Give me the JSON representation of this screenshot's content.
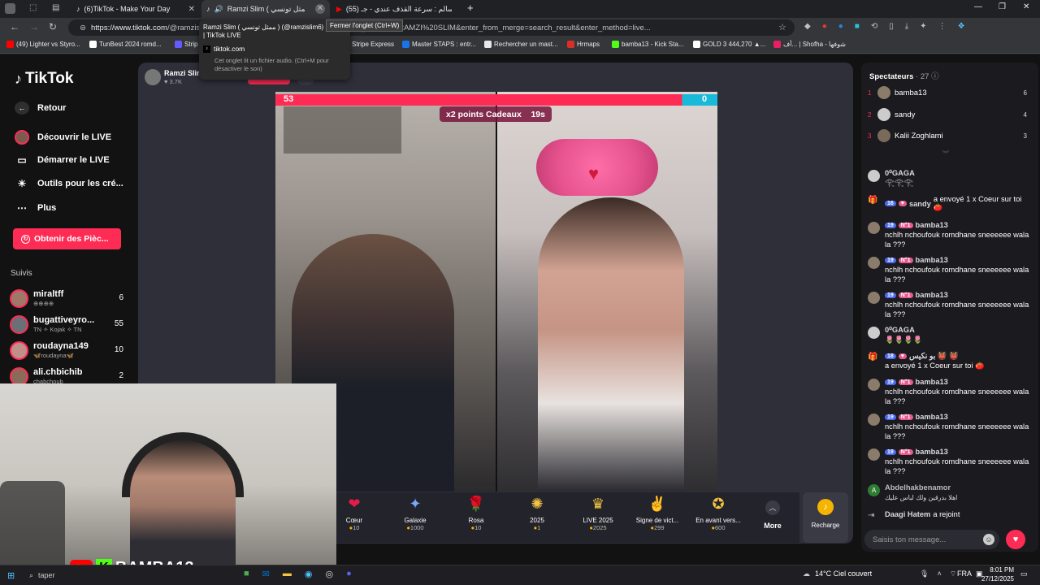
{
  "browser": {
    "tabs": [
      {
        "title": "(6)TikTok - Make Your Day",
        "active": false
      },
      {
        "title": "Ramzi Slim ( ممثل تونسي ) (",
        "active": true
      },
      {
        "title": "(55) سالم : سرعة القذف عندي - جـ",
        "active": false
      }
    ],
    "new_tab": "+",
    "url_host": "https://www.tiktok.com",
    "url_rest": "/@ramzislim",
    "url_tail": "0653EAACB0FA28&search_keyword=RAMZI%20SLIM&enter_from_merge=search_result&enter_method=live...",
    "tooltip": "Fermer l'onglet (Ctrl+W)",
    "hover_card": {
      "title": "Ramzi Slim ( ممثل تونسي ) (@ramzislim6) e LIVE | TikTok LIVE",
      "domain": "tiktok.com",
      "note": "Cet onglet lit un fichier audio. (Ctrl+M pour désactiver le son)"
    },
    "bookmarks": [
      {
        "label": "(49) Lighter vs Styro...",
        "color": "#ff0000"
      },
      {
        "label": "TunBest 2024 romd...",
        "color": "#ffffff"
      },
      {
        "label": "Strip",
        "color": "#635bff"
      },
      {
        "label": "Stripe Express",
        "color": "#635bff"
      },
      {
        "label": "Master STAPS : entr...",
        "color": "#1a73e8"
      },
      {
        "label": "Rechercher un mast...",
        "color": "#e8e8e8"
      },
      {
        "label": "Hrmaps",
        "color": "#d93025"
      },
      {
        "label": "bamba13 - Kick Sta...",
        "color": "#53fc18"
      },
      {
        "label": "GOLD 3 444,270 ▲...",
        "color": "#ffffff"
      },
      {
        "label": "أف... | Shofha - شوفها",
        "color": "#e91e63"
      }
    ]
  },
  "sidebar": {
    "logo": "TikTok",
    "back": "Retour",
    "items": [
      {
        "label": "Découvrir le LIVE",
        "icon": "live-avatar-icon"
      },
      {
        "label": "Démarrer le LIVE",
        "icon": "camera-icon"
      },
      {
        "label": "Outils pour les cré...",
        "icon": "lightbulb-icon"
      },
      {
        "label": "Plus",
        "icon": "more-dots-icon"
      }
    ],
    "coins_button": "Obtenir des Pièc...",
    "following_title": "Suivis",
    "following": [
      {
        "name": "miraltff",
        "sub": "⊕⊕⊕⊕",
        "count": "6"
      },
      {
        "name": "bugattiveyro...",
        "sub": "TN ✧ Kojak ✧ TN",
        "count": "55"
      },
      {
        "name": "roudayna149",
        "sub": "🦋roudayna🦋",
        "count": "10"
      },
      {
        "name": "ali.chbichib",
        "sub": "chabchoub",
        "count": "2"
      }
    ]
  },
  "stream": {
    "host_name": "Ramzi Slim",
    "host_viewers": "3.7K",
    "score_left": "53",
    "score_right": "0",
    "multiplier": "x2 points Cadeaux",
    "timer": "19s"
  },
  "gifts": [
    {
      "name": "Cœur",
      "price": "10",
      "icon": "❤"
    },
    {
      "name": "Galaxie",
      "price": "1000",
      "icon": "✦"
    },
    {
      "name": "Rosa",
      "price": "10",
      "icon": "🌹"
    },
    {
      "name": "2025",
      "price": "1",
      "icon": "✺"
    },
    {
      "name": "LIVE 2025",
      "price": "2025",
      "icon": "♛"
    },
    {
      "name": "Signe de vict...",
      "price": "299",
      "icon": "✌"
    },
    {
      "name": "En avant vers...",
      "price": "600",
      "icon": "✪"
    }
  ],
  "more_label": "More",
  "recharge_label": "Recharge",
  "chat": {
    "viewers_title": "Spectateurs",
    "viewers_count": "27",
    "ranking": [
      {
        "rank": "1",
        "name": "bamba13",
        "count": "6"
      },
      {
        "rank": "2",
        "name": "sandy",
        "count": "4"
      },
      {
        "rank": "3",
        "name": "Kalii Zoghlami",
        "count": "3"
      }
    ],
    "messages": [
      {
        "user": "0⁰GAGA",
        "badges": [],
        "text": "𓂀𓂀𓂀"
      },
      {
        "user": "sandy",
        "badges": [
          "16",
          "♥"
        ],
        "text": "a envoyé 1 x Coeur sur toi 🍅",
        "gift": true
      },
      {
        "user": "bamba13",
        "badges": [
          "19",
          "N°1"
        ],
        "text": "nchlh nchoufouk romdhane sneeeeee wala la ???"
      },
      {
        "user": "bamba13",
        "badges": [
          "19",
          "N°1"
        ],
        "text": "nchlh nchoufouk romdhane sneeeeee wala la ???"
      },
      {
        "user": "bamba13",
        "badges": [
          "19",
          "N°1"
        ],
        "text": "nchlh nchoufouk romdhane sneeeeee wala la ???"
      },
      {
        "user": "0⁰GAGA",
        "badges": [],
        "text": "🌷🌷🌷🌷"
      },
      {
        "user": "بو نكيس 👹 👹",
        "badges": [
          "18",
          "♥"
        ],
        "text": "a envoyé 1 x Coeur sur toi 🍅",
        "gift": true
      },
      {
        "user": "bamba13",
        "badges": [
          "19",
          "N°1"
        ],
        "text": "nchlh nchoufouk romdhane sneeeeee wala la ???"
      },
      {
        "user": "bamba13",
        "badges": [
          "19",
          "N°1"
        ],
        "text": "nchlh nchoufouk romdhane sneeeeee wala la ???"
      },
      {
        "user": "bamba13",
        "badges": [
          "19",
          "N°1"
        ],
        "text": "nchlh nchoufouk romdhane sneeeeee wala la ???"
      },
      {
        "user": "Abdelhakbenamor",
        "badges": [],
        "text": "اهلا بدرقين ولك لباس عليك"
      },
      {
        "user": "Daagi Hatem",
        "badges": [],
        "text": "a rejoint",
        "join": true
      }
    ],
    "input_placeholder": "Saisis ton message..."
  },
  "overlay": {
    "brand": "BAMBA13"
  },
  "taskbar": {
    "search": "taper",
    "weather": "14°C  Ciel couvert",
    "lang": "FRA",
    "time": "8:01 PM",
    "date": "27/12/2025"
  }
}
